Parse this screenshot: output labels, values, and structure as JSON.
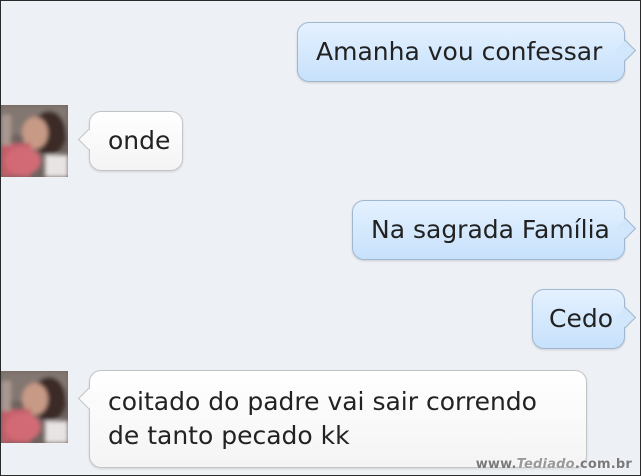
{
  "messages": [
    {
      "side": "sent",
      "text": "Amanha vou confessar"
    },
    {
      "side": "received",
      "text": "onde"
    },
    {
      "side": "sent",
      "text": "Na sagrada Família"
    },
    {
      "side": "sent",
      "text": "Cedo"
    },
    {
      "side": "received",
      "lines": [
        "coitado do padre vai sair correndo",
        "de tanto pecado kk"
      ]
    }
  ],
  "watermark": {
    "prefix": "www.",
    "brand": "Tediado",
    "suffix": ".com.br"
  },
  "icons": {
    "avatar": "contact-photo-icon"
  }
}
